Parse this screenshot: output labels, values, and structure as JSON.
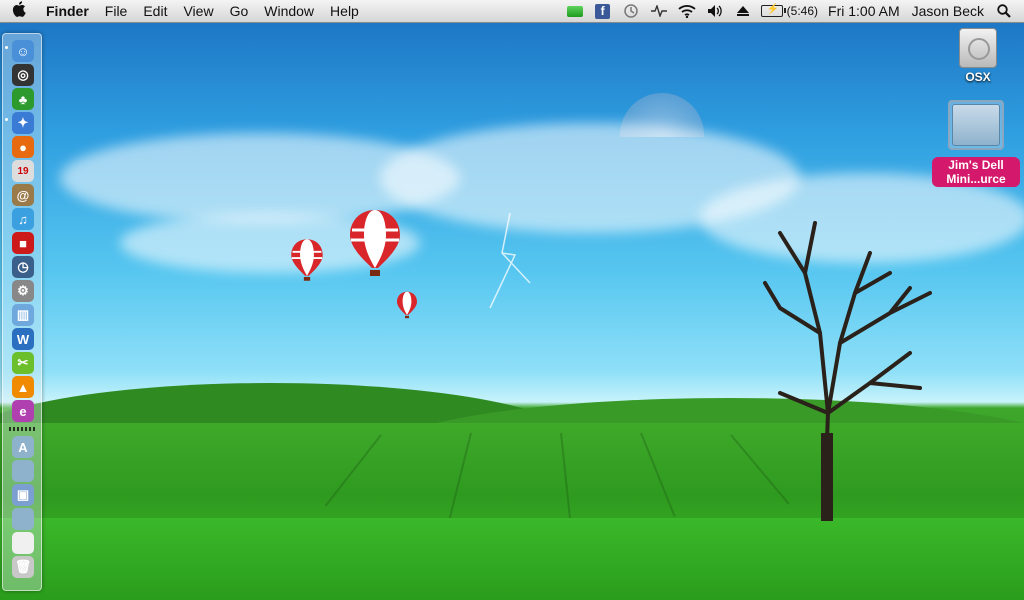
{
  "menubar": {
    "app_name": "Finder",
    "menus": [
      "File",
      "Edit",
      "View",
      "Go",
      "Window",
      "Help"
    ],
    "status": {
      "facebook_label": "f",
      "battery_time": "(5:46)",
      "clock": "Fri 1:00 AM",
      "user": "Jason Beck"
    }
  },
  "desktop": {
    "icons": [
      {
        "label": "OSX",
        "kind": "hard-drive-icon"
      },
      {
        "label": "Jim's Dell Mini...urce",
        "label_line1": "Jim's Dell",
        "label_line2": "Mini...urce",
        "kind": "folder-icon",
        "selected": true
      }
    ]
  },
  "dock": {
    "items": [
      {
        "name": "finder",
        "color": "#4a90d9",
        "glyph": "☺"
      },
      {
        "name": "dashboard",
        "color": "#333333",
        "glyph": "◎"
      },
      {
        "name": "tree-app",
        "color": "#2d9a2d",
        "glyph": "♣"
      },
      {
        "name": "safari",
        "color": "#3a7bd5",
        "glyph": "✦"
      },
      {
        "name": "firefox",
        "color": "#e86a10",
        "glyph": "●"
      },
      {
        "name": "ical",
        "color": "#dddddd",
        "glyph": "19"
      },
      {
        "name": "address-book",
        "color": "#9b7a4a",
        "glyph": "@"
      },
      {
        "name": "itunes",
        "color": "#3aa0e0",
        "glyph": "♫"
      },
      {
        "name": "photo-booth",
        "color": "#cc1a1a",
        "glyph": "■"
      },
      {
        "name": "time-machine",
        "color": "#3a5f8a",
        "glyph": "◷"
      },
      {
        "name": "system-preferences",
        "color": "#888888",
        "glyph": "⚙"
      },
      {
        "name": "activity-chart",
        "color": "#6fa8dc",
        "glyph": "▥"
      },
      {
        "name": "word-app",
        "color": "#2a6fc0",
        "glyph": "W"
      },
      {
        "name": "limewire",
        "color": "#6abf2a",
        "glyph": "✂"
      },
      {
        "name": "vlc-cone",
        "color": "#f08a00",
        "glyph": "▲"
      },
      {
        "name": "messenger",
        "color": "#b040b0",
        "glyph": "e"
      },
      {
        "name": "applications-folder",
        "color": "#8fb2cc",
        "glyph": "A"
      },
      {
        "name": "documents-folder",
        "color": "#8fb2cc",
        "glyph": ""
      },
      {
        "name": "preview",
        "color": "#7a9fd0",
        "glyph": "▣"
      },
      {
        "name": "downloads-folder",
        "color": "#8fb2cc",
        "glyph": ""
      },
      {
        "name": "stack",
        "color": "#f0f0f0",
        "glyph": ""
      },
      {
        "name": "trash",
        "color": "#c8c8c8",
        "glyph": "🗑"
      }
    ]
  }
}
